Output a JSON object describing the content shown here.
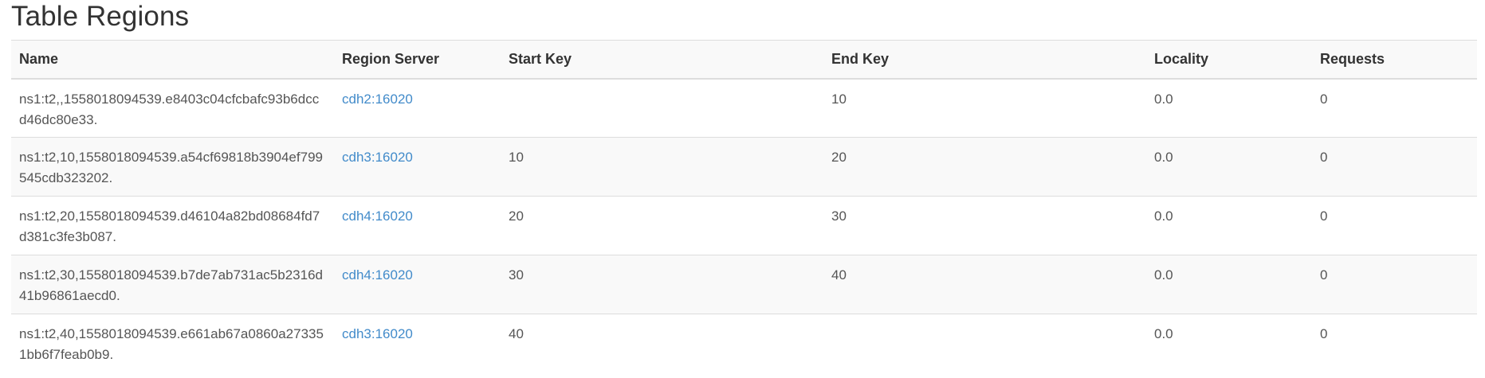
{
  "page": {
    "title": "Table Regions"
  },
  "table": {
    "headers": {
      "name": "Name",
      "region_server": "Region Server",
      "start_key": "Start Key",
      "end_key": "End Key",
      "locality": "Locality",
      "requests": "Requests"
    },
    "rows": [
      {
        "name": "ns1:t2,,1558018094539.e8403c04cfcbafc93b6dccd46dc80e33.",
        "region_server": "cdh2:16020",
        "start_key": "",
        "end_key": "10",
        "locality": "0.0",
        "requests": "0"
      },
      {
        "name": "ns1:t2,10,1558018094539.a54cf69818b3904ef799545cdb323202.",
        "region_server": "cdh3:16020",
        "start_key": "10",
        "end_key": "20",
        "locality": "0.0",
        "requests": "0"
      },
      {
        "name": "ns1:t2,20,1558018094539.d46104a82bd08684fd7d381c3fe3b087.",
        "region_server": "cdh4:16020",
        "start_key": "20",
        "end_key": "30",
        "locality": "0.0",
        "requests": "0"
      },
      {
        "name": "ns1:t2,30,1558018094539.b7de7ab731ac5b2316d41b96861aecd0.",
        "region_server": "cdh4:16020",
        "start_key": "30",
        "end_key": "40",
        "locality": "0.0",
        "requests": "0"
      },
      {
        "name": "ns1:t2,40,1558018094539.e661ab67a0860a273351bb6f7feab0b9.",
        "region_server": "cdh3:16020",
        "start_key": "40",
        "end_key": "",
        "locality": "0.0",
        "requests": "0"
      }
    ]
  },
  "colors": {
    "link": "#428bca",
    "text": "#555555",
    "heading": "#333333",
    "stripe": "#f9f9f9",
    "border": "#dddddd"
  }
}
